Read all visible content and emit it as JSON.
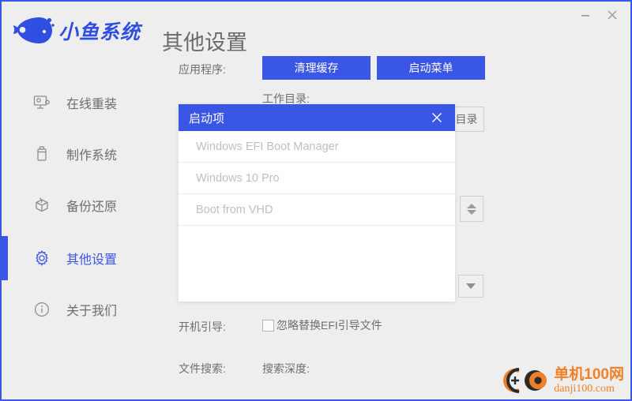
{
  "window": {
    "accent_color": "#3a56e4",
    "background": "#eeeeee",
    "minimize_label": "—",
    "close_label": "✕"
  },
  "brand": {
    "name": "小鱼系统",
    "logo_icon": "fish-logo-icon"
  },
  "sidebar": {
    "items": [
      {
        "label": "在线重装",
        "icon": "monitor-icon",
        "active": false
      },
      {
        "label": "制作系统",
        "icon": "usb-drive-icon",
        "active": false
      },
      {
        "label": "备份还原",
        "icon": "backup-restore-icon",
        "active": false
      },
      {
        "label": "其他设置",
        "icon": "gear-icon",
        "active": true
      },
      {
        "label": "关于我们",
        "icon": "info-icon",
        "active": false
      }
    ]
  },
  "main": {
    "page_title": "其他设置",
    "app_row": {
      "label": "应用程序:",
      "clear_cache_button": "清理缓存",
      "boot_menu_button": "启动菜单"
    },
    "workdir_row": {
      "label": "工作目录:",
      "browse_button": "目录"
    },
    "boot_row": {
      "label": "开机引导:",
      "checkbox_label": "忽略替换EFI引导文件",
      "checked": false
    },
    "search_row": {
      "label": "文件搜索:",
      "depth_label": "搜索深度:"
    },
    "spinner": {
      "up_icon": "caret-up-icon",
      "down_icon": "caret-down-icon"
    },
    "dropdown": {
      "icon": "caret-down-icon"
    }
  },
  "dialog": {
    "title": "启动项",
    "close_icon": "close-icon",
    "items": [
      {
        "label": "Windows EFI Boot Manager"
      },
      {
        "label": "Windows 10 Pro"
      },
      {
        "label": "Boot from VHD"
      }
    ]
  },
  "watermark": {
    "cn": "单机100网",
    "en": "danji100.com",
    "logo_icon": "danji100-logo-icon"
  }
}
